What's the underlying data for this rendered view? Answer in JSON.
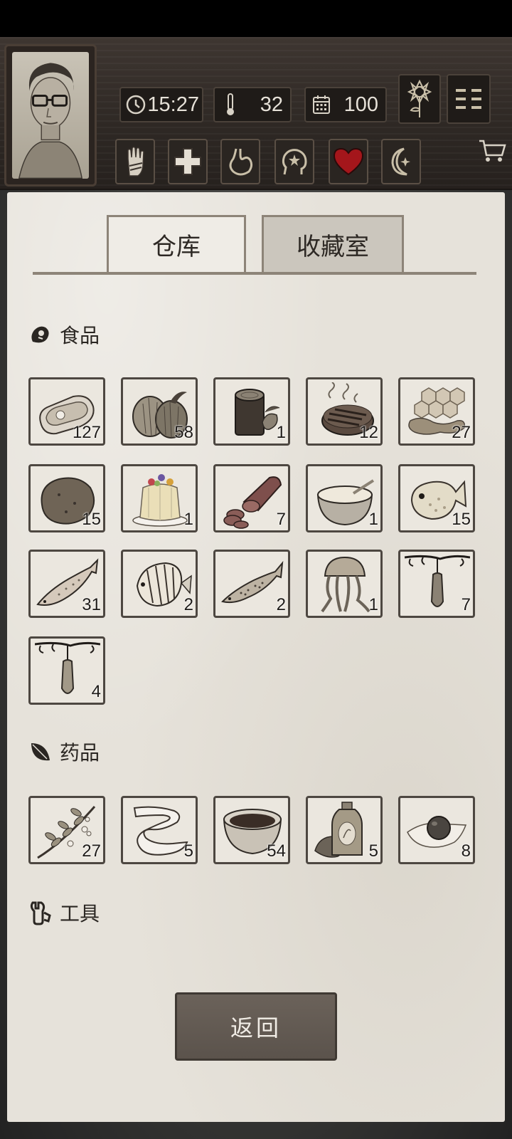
{
  "hud": {
    "time": "15:27",
    "temperature": "32",
    "days": "100"
  },
  "status_icons": [
    {
      "name": "hand-icon"
    },
    {
      "name": "health-cross-icon"
    },
    {
      "name": "stomach-icon"
    },
    {
      "name": "mind-icon"
    },
    {
      "name": "heart-icon"
    },
    {
      "name": "moon-icon"
    }
  ],
  "tabs": {
    "warehouse": "仓库",
    "collection": "收藏室"
  },
  "sections": {
    "food": "食品",
    "medicine": "药品",
    "tools": "工具"
  },
  "food_items": [
    {
      "icon": "raw-meat-icon",
      "count": "127"
    },
    {
      "icon": "coconut-icon",
      "count": "58"
    },
    {
      "icon": "cocoa-log-icon",
      "count": "1"
    },
    {
      "icon": "grilled-steak-icon",
      "count": "12"
    },
    {
      "icon": "honeycomb-icon",
      "count": "27"
    },
    {
      "icon": "potato-icon",
      "count": "15"
    },
    {
      "icon": "jelly-cake-icon",
      "count": "1"
    },
    {
      "icon": "sausage-icon",
      "count": "7"
    },
    {
      "icon": "porridge-bowl-icon",
      "count": "1"
    },
    {
      "icon": "pufferfish-icon",
      "count": "15"
    },
    {
      "icon": "salmon-icon",
      "count": "31"
    },
    {
      "icon": "butterflyfish-icon",
      "count": "2"
    },
    {
      "icon": "trout-icon",
      "count": "2"
    },
    {
      "icon": "jellyfish-icon",
      "count": "1"
    },
    {
      "icon": "hanging-fruit-icon",
      "count": "7"
    },
    {
      "icon": "hanging-fruit-icon",
      "count": "4"
    }
  ],
  "medicine_items": [
    {
      "icon": "herb-branch-icon",
      "count": "27"
    },
    {
      "icon": "bandage-icon",
      "count": "5"
    },
    {
      "icon": "herbal-tea-bowl-icon",
      "count": "54"
    },
    {
      "icon": "medicine-bottle-icon",
      "count": "5"
    },
    {
      "icon": "pill-on-cloth-icon",
      "count": "8"
    }
  ],
  "back_button": "返回"
}
